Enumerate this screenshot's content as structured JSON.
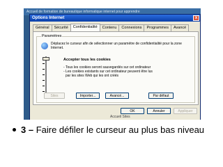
{
  "dialog": {
    "title": "Options Internet",
    "close_glyph": "x"
  },
  "background_text": "Accueil de formation de bureautique informatique internet pour apprendre",
  "tabs": [
    {
      "label": "Général"
    },
    {
      "label": "Sécurité"
    },
    {
      "label": "Confidentialité"
    },
    {
      "label": "Contenu"
    },
    {
      "label": "Connexions"
    },
    {
      "label": "Programmes"
    },
    {
      "label": "Avancé"
    }
  ],
  "settings": {
    "group_label": "Paramètres",
    "description": "Déplacez le curseur afin de sélectionner un paramètre de confidentialité pour la zone Internet.",
    "level_title": "Accepter tous les cookies",
    "level_desc_lines": [
      "- Tous les cookies seront sauvegardés sur cet ordinateur",
      "- Les cookies existants sur cet ordinateur peuvent être lus",
      "  par les sites Web qui les ont créés"
    ],
    "slider_level_fraction": 0
  },
  "panel_buttons": {
    "sites": "Sites",
    "import": "Importer...",
    "advanced": "Avancé...",
    "default": "Par défaut"
  },
  "dialog_buttons": {
    "ok": "OK",
    "cancel": "Annuler",
    "apply": "Appliquer"
  },
  "overlay_text": "Accueil Sites",
  "caption": {
    "step": "3 –",
    "text": " Faire défiler le curseur au plus bas niveau"
  }
}
